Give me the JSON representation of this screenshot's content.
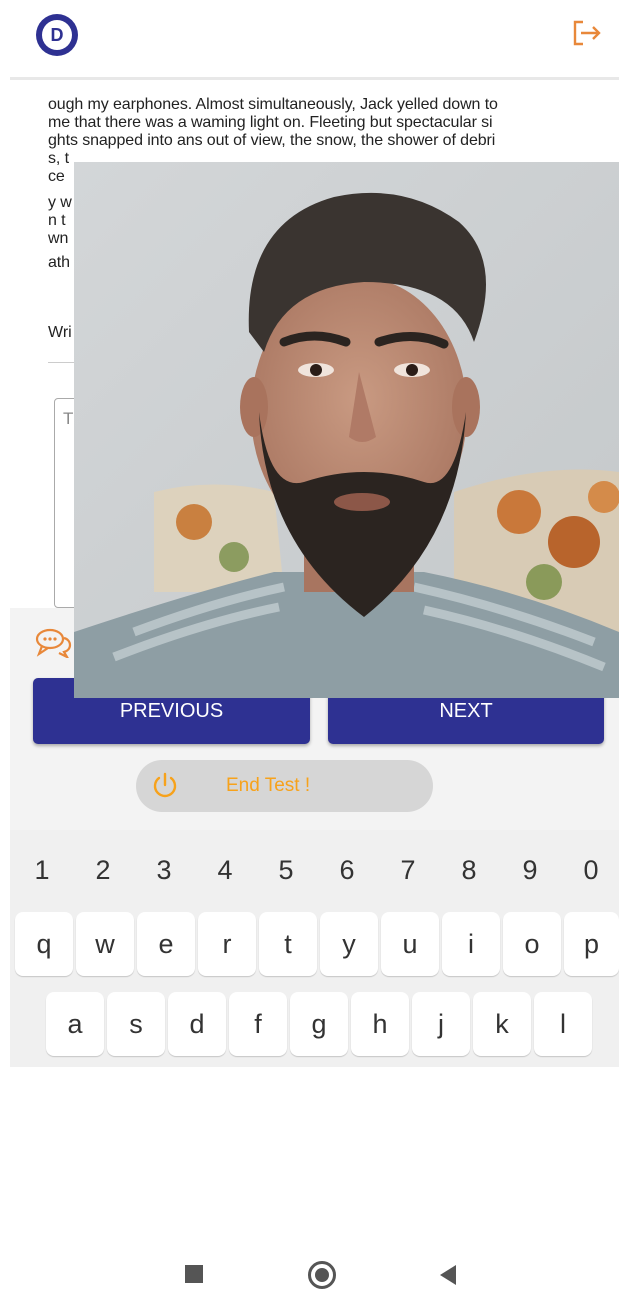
{
  "header": {
    "logo_letter": "D",
    "logout_icon": "logout-icon"
  },
  "passage": {
    "lines": [
      "ough my earphones. Almost simultaneously, Jack yelled down to",
      "me that there was a waming light on. Fleeting but spectacular si",
      "ghts snapped into ans out of view, the snow, the shower of debri"
    ],
    "fragments": [
      "s, t",
      "ce",
      "y w",
      "n t",
      "wn",
      "ath"
    ]
  },
  "instruction_fragment": "Wri",
  "answer": {
    "placeholder_fragment": "T"
  },
  "buttons": {
    "previous": "PREVIOUS",
    "next": "NEXT",
    "end_test": "End Test !"
  },
  "keyboard": {
    "numbers": [
      "1",
      "2",
      "3",
      "4",
      "5",
      "6",
      "7",
      "8",
      "9",
      "0"
    ],
    "row1": [
      "q",
      "w",
      "e",
      "r",
      "t",
      "y",
      "u",
      "i",
      "o",
      "p"
    ],
    "row2": [
      "a",
      "s",
      "d",
      "f",
      "g",
      "h",
      "j",
      "k",
      "l"
    ]
  },
  "colors": {
    "brand": "#2e3192",
    "accent": "#f7a21b",
    "logout_orange": "#e8883a"
  }
}
